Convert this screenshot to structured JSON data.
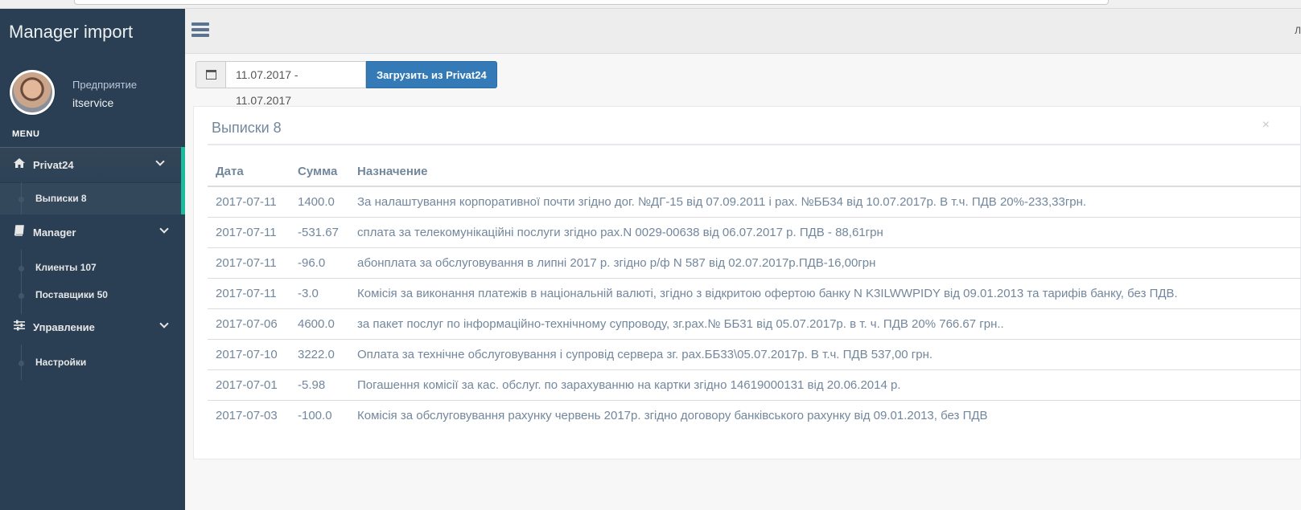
{
  "app": {
    "brand": "Manager import"
  },
  "profile": {
    "label": "Предприятие",
    "name": "itservice"
  },
  "menu": {
    "title": "MENU",
    "sections": [
      {
        "label": "Privat24",
        "icon": "home-icon",
        "items": [
          {
            "label": "Выписки 8"
          }
        ]
      },
      {
        "label": "Manager",
        "icon": "book-icon",
        "items": [
          {
            "label": "Клиенты 107"
          },
          {
            "label": "Поставщики 50"
          }
        ]
      },
      {
        "label": "Управление",
        "icon": "sliders-icon",
        "items": [
          {
            "label": "Настройки"
          }
        ]
      }
    ]
  },
  "topnav": {
    "edge_text": "Л"
  },
  "toolbar": {
    "date_range": "11.07.2017 - 11.07.2017",
    "load_button": "Загрузить из Privat24"
  },
  "panel": {
    "title": "Выписки 8",
    "close_glyph": "×",
    "columns": [
      "Дата",
      "Сумма",
      "Назначение"
    ],
    "rows": [
      [
        "2017-07-11",
        "1400.0",
        "За налаштування корпоративної почти згідно дог. №ДГ-15 від 07.09.2011 і рах. №ББ34 від 10.07.2017р. В т.ч. ПДВ 20%-233,33грн."
      ],
      [
        "2017-07-11",
        "-531.67",
        "сплата за телекомунікаційні послуги згідно рах.N 0029-00638 від 06.07.2017 р. ПДВ - 88,61грн"
      ],
      [
        "2017-07-11",
        "-96.0",
        "абонплата за обслуговування в липні 2017 р. згідно р/ф N 587 від 02.07.2017р.ПДВ-16,00грн"
      ],
      [
        "2017-07-11",
        "-3.0",
        "Комісія за виконання платежів в національній валюті, згідно з відкритою офертою банку N K3ILWWPIDY від 09.01.2013 та тарифів банку, без ПДВ."
      ],
      [
        "2017-07-06",
        "4600.0",
        "за пакет послуг по інформаційно-технічному супроводу, зг.рах.№ ББ31 від 05.07.2017р. в т. ч. ПДВ 20% 766.67 грн.."
      ],
      [
        "2017-07-10",
        "3222.0",
        "Оплата за технічне обслуговування і супровід сервера зг. рах.ББ33\\05.07.2017р. В т.ч. ПДВ 537,00 грн."
      ],
      [
        "2017-07-01",
        "-5.98",
        "Погашення комісії за кас. обслуг. по зарахуванню на картки згідно 14619000131 від 20.06.2014 р."
      ],
      [
        "2017-07-03",
        "-100.0",
        "Комісія за обслуговування рахунку червень 2017р. згідно договору банківського рахунку від 09.01.2013, без ПДВ"
      ]
    ]
  },
  "colors": {
    "sidebar": "#2a3f54",
    "accent": "#1abb9c",
    "primary_button": "#337ab7"
  }
}
